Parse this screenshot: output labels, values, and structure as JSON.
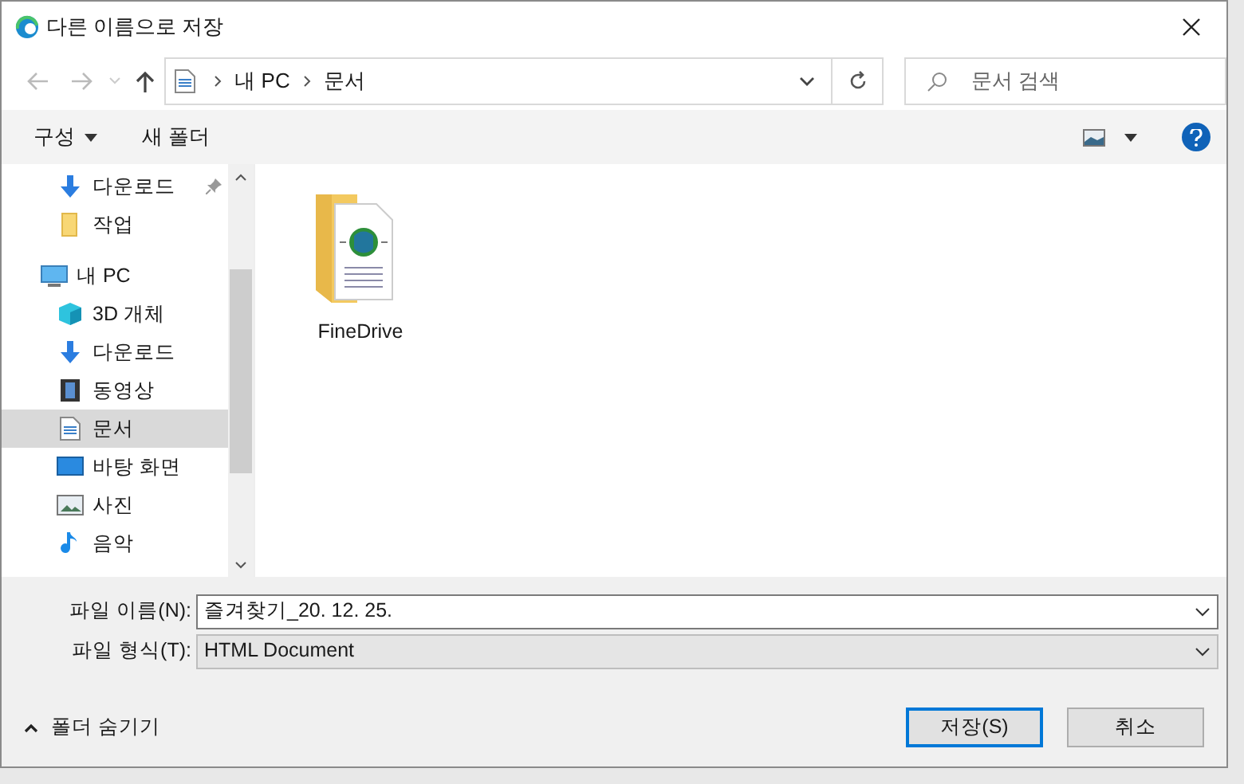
{
  "window": {
    "title": "다른 이름으로 저장"
  },
  "address": {
    "path": [
      "내 PC",
      "문서"
    ],
    "search_placeholder": "문서 검색"
  },
  "toolbar": {
    "organize": "구성",
    "new_folder": "새 폴더"
  },
  "sidebar": {
    "items": [
      {
        "label": "다운로드",
        "pinned": true,
        "selected": false
      },
      {
        "label": "작업",
        "pinned": false,
        "selected": false
      },
      {
        "label": "내 PC",
        "selected": false,
        "children": [
          {
            "label": "3D 개체",
            "selected": false
          },
          {
            "label": "다운로드",
            "selected": false
          },
          {
            "label": "동영상",
            "selected": false
          },
          {
            "label": "문서",
            "selected": true
          },
          {
            "label": "바탕 화면",
            "selected": false
          },
          {
            "label": "사진",
            "selected": false
          },
          {
            "label": "음악",
            "selected": false
          }
        ]
      }
    ]
  },
  "files": [
    {
      "name": "FineDrive"
    }
  ],
  "form": {
    "filename_label": "파일 이름(N):",
    "filename": "즐겨찾기_20. 12. 25.",
    "type_label": "파일 형식(T):",
    "type": "HTML Document"
  },
  "hide_folders": "폴더 숨기기",
  "buttons": [
    {
      "label": "저장(S)",
      "default": true
    },
    {
      "label": "취소",
      "default": false
    }
  ]
}
